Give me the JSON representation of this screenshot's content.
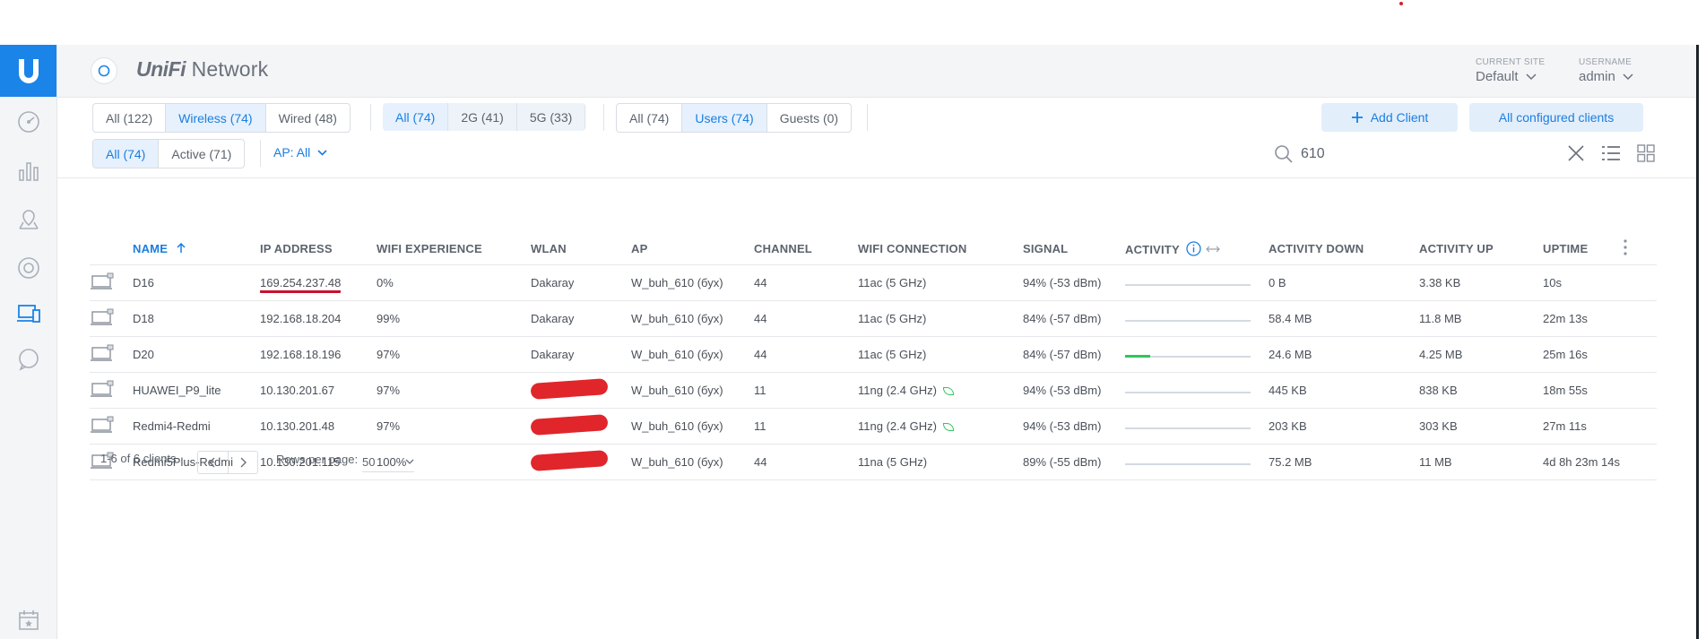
{
  "app": {
    "brand_first": "UniFi",
    "brand_second": " Network"
  },
  "header": {
    "site_label": "CURRENT SITE",
    "site_value": "Default",
    "user_label": "USERNAME",
    "user_value": "admin"
  },
  "filters": {
    "connection": [
      {
        "label": "All (122)",
        "active": false
      },
      {
        "label": "Wireless (74)",
        "active": true
      },
      {
        "label": "Wired (48)",
        "active": false
      }
    ],
    "band": [
      {
        "label": "All (74)",
        "active": true
      },
      {
        "label": "2G (41)",
        "active": false
      },
      {
        "label": "5G (33)",
        "active": false
      }
    ],
    "user_type": [
      {
        "label": "All (74)",
        "active": false
      },
      {
        "label": "Users (74)",
        "active": true
      },
      {
        "label": "Guests (0)",
        "active": false
      }
    ],
    "state": [
      {
        "label": "All (74)",
        "active": true
      },
      {
        "label": "Active (71)",
        "active": false
      }
    ],
    "ap_filter": "AP: All"
  },
  "buttons": {
    "add_client": "Add Client",
    "all_configured": "All configured clients"
  },
  "search": {
    "value": "610"
  },
  "table": {
    "columns": [
      "NAME",
      "IP ADDRESS",
      "WIFI EXPERIENCE",
      "WLAN",
      "AP",
      "CHANNEL",
      "WIFI CONNECTION",
      "SIGNAL",
      "ACTIVITY",
      "ACTIVITY DOWN",
      "ACTIVITY UP",
      "UPTIME"
    ],
    "sorted_column": "NAME",
    "rows": [
      {
        "name": "D16",
        "ip": "169.254.237.48",
        "experience": "0%",
        "wlan": "Dakaray",
        "ap": "W_buh_610 (бух)",
        "channel": "44",
        "connection": "11ac (5 GHz)",
        "signal": "94% (-53 dBm)",
        "activity": 0,
        "down": "0 B",
        "up": "3.38 KB",
        "uptime": "10s"
      },
      {
        "name": "D18",
        "ip": "192.168.18.204",
        "experience": "99%",
        "wlan": "Dakaray",
        "ap": "W_buh_610 (бух)",
        "channel": "44",
        "connection": "11ac (5 GHz)",
        "signal": "84% (-57 dBm)",
        "activity": 0,
        "down": "58.4 MB",
        "up": "11.8 MB",
        "uptime": "22m 13s"
      },
      {
        "name": "D20",
        "ip": "192.168.18.196",
        "experience": "97%",
        "wlan": "Dakaray",
        "ap": "W_buh_610 (бух)",
        "channel": "44",
        "connection": "11ac (5 GHz)",
        "signal": "84% (-57 dBm)",
        "activity": 0.2,
        "down": "24.6 MB",
        "up": "4.25 MB",
        "uptime": "25m 16s"
      },
      {
        "name": "HUAWEI_P9_lite",
        "ip": "10.130.201.67",
        "experience": "97%",
        "wlan": "",
        "ap": "W_buh_610 (бух)",
        "channel": "11",
        "connection": "11ng (2.4 GHz)",
        "signal": "94% (-53 dBm)",
        "activity": 0,
        "down": "445 KB",
        "up": "838 KB",
        "uptime": "18m 55s"
      },
      {
        "name": "Redmi4-Redmi",
        "ip": "10.130.201.48",
        "experience": "97%",
        "wlan": "",
        "ap": "W_buh_610 (бух)",
        "channel": "11",
        "connection": "11ng (2.4 GHz)",
        "signal": "94% (-53 dBm)",
        "activity": 0,
        "down": "203 KB",
        "up": "303 KB",
        "uptime": "27m 11s"
      },
      {
        "name": "Redmi5Plus-Redmi",
        "ip": "10.130.201.115",
        "experience": "100%",
        "wlan": "",
        "ap": "W_buh_610 (бух)",
        "channel": "44",
        "connection": "11na (5 GHz)",
        "signal": "89% (-55 dBm)",
        "activity": 0,
        "down": "75.2 MB",
        "up": "11 MB",
        "uptime": "4d 8h 23m 14s"
      }
    ]
  },
  "footer": {
    "count": "1-6 of 6 clients",
    "rows_per_page_label": "Rows per page:",
    "rows_per_page_value": "50"
  }
}
